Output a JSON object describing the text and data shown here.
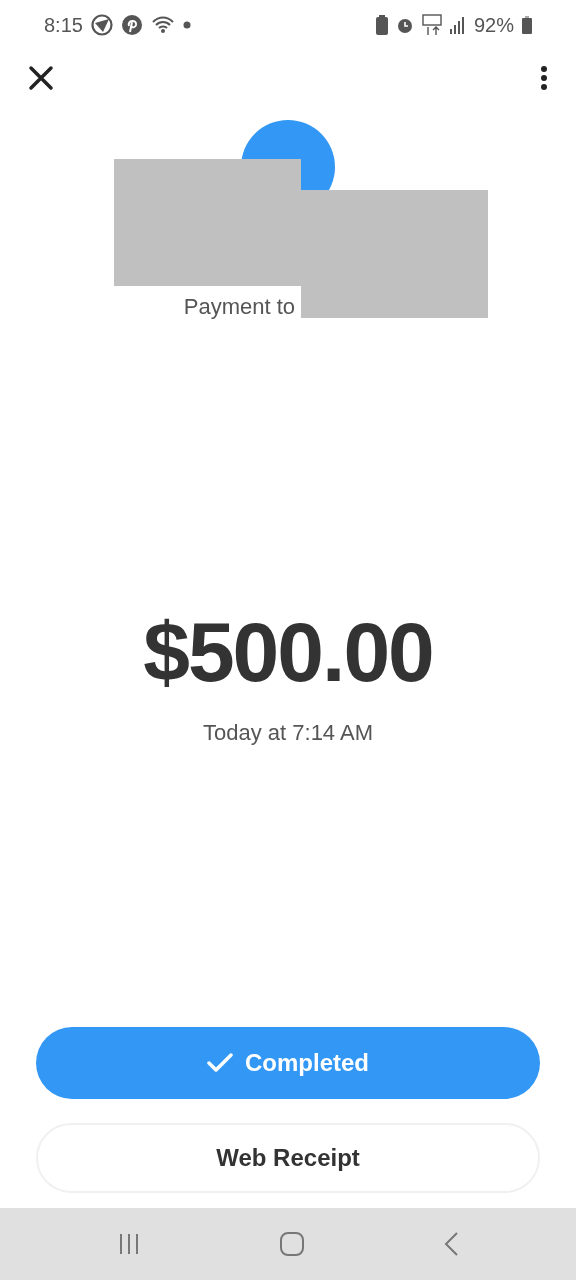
{
  "status_bar": {
    "time": "8:15",
    "battery": "92%"
  },
  "header": {
    "subtitle": "Payment to"
  },
  "amount": "$500.00",
  "date": "Today at 7:14 AM",
  "buttons": [
    {
      "kind": "status",
      "label": "Completed"
    },
    {
      "kind": "outline",
      "label": "Web Receipt"
    }
  ]
}
